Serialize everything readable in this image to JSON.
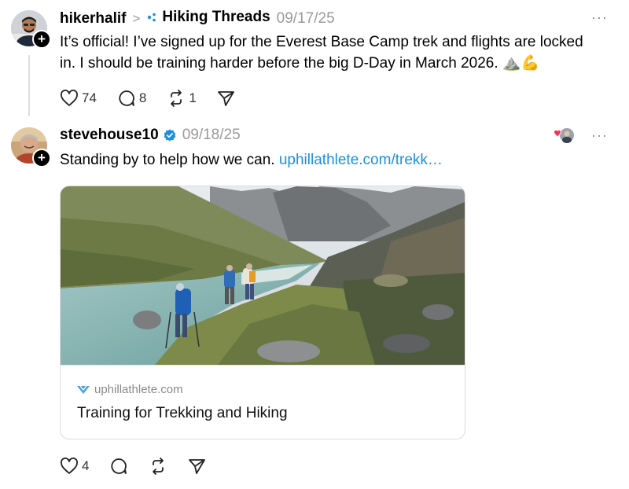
{
  "post1": {
    "username": "hikerhalif",
    "separator": ">",
    "community_name": "Hiking Threads",
    "date": "09/17/25",
    "more": "···",
    "text_line1": "It’s official! I’ve signed up for the Everest Base Camp trek and flights are locked",
    "text_line2": "in. I should be training harder before the big D-Day in March 2026. ⛰️💪",
    "likes": "74",
    "comments": "8",
    "reposts": "1",
    "follow_glyph": "+"
  },
  "post2": {
    "username": "stevehouse10",
    "date": "09/18/25",
    "more": "···",
    "text": "Standing by to help how we can.",
    "link_text": "uphillathlete.com/trekk…",
    "card": {
      "domain": "uphillathlete.com",
      "title": "Training for Trekking and Hiking"
    },
    "likes": "4",
    "follow_glyph": "+"
  },
  "icons": {
    "like": "heart-icon",
    "comment": "comment-icon",
    "repost": "repost-icon",
    "share": "share-icon",
    "verified": "verified-badge-icon",
    "community": "community-dots-icon"
  },
  "colors": {
    "link": "#1d8fe0",
    "verified": "#1d8fe0",
    "muted": "#9a9a9a"
  }
}
